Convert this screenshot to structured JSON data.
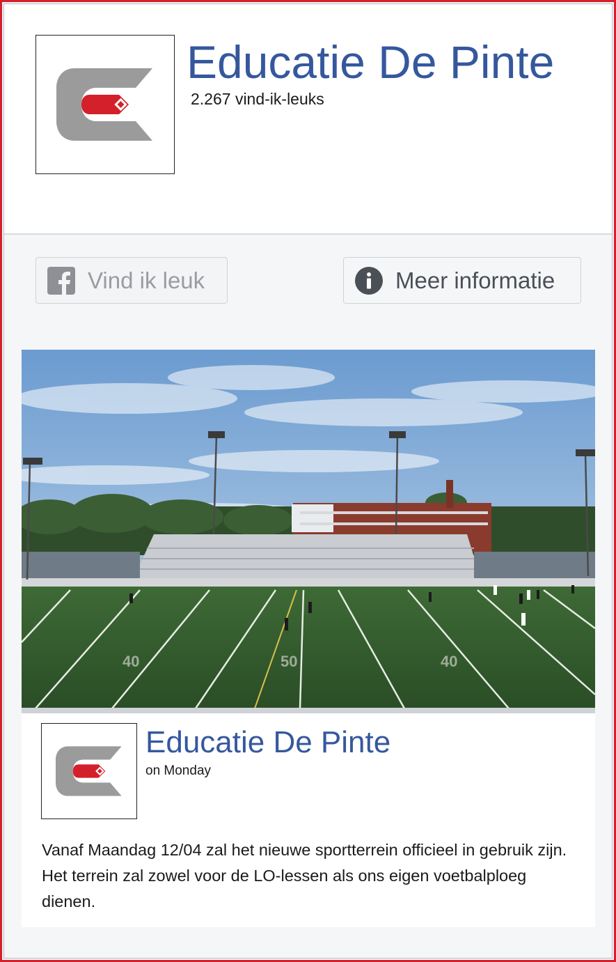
{
  "page": {
    "title": "Educatie De Pinte",
    "likes": "2.267 vind-ik-leuks"
  },
  "buttons": {
    "like_label": "Vind ik leuk",
    "like_icon": "facebook-icon",
    "info_label": "Meer informatie",
    "info_icon": "info-icon"
  },
  "post": {
    "author": "Educatie De Pinte",
    "time": "on Monday",
    "text": "Vanaf Maandag 12/04 zal het nieuwe sportterrein officieel in gebruik zijn. Het terrein zal zowel voor de LO-lessen als ons eigen voetbalploeg dienen."
  },
  "colors": {
    "brand_blue": "#35589d",
    "frame_red": "#d4202a",
    "logo_gray": "#9b9b9b",
    "logo_red": "#d4202a"
  }
}
